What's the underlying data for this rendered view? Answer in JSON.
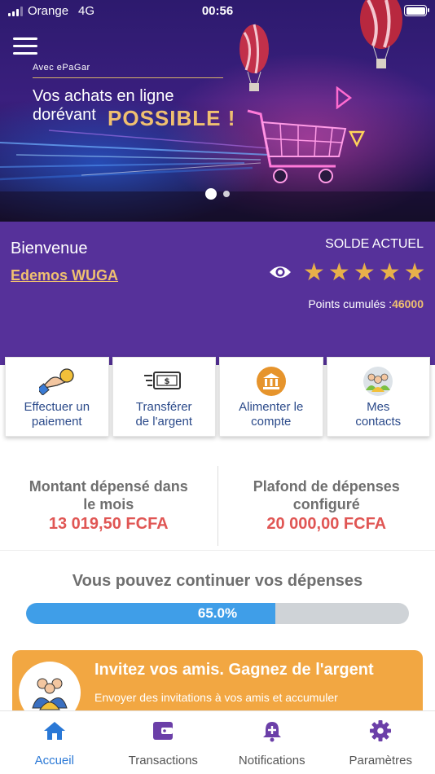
{
  "status_bar": {
    "carrier": "Orange",
    "network": "4G",
    "time": "00:56"
  },
  "banner": {
    "small": "Avec ePaGar",
    "line1": "Vos achats en ligne",
    "line2": "dorévant",
    "highlight": "POSSIBLE !",
    "slides": 2,
    "active_slide": 1
  },
  "welcome": {
    "greeting": "Bienvenue",
    "username": "Edemos WUGA",
    "balance_label": "SOLDE ACTUEL",
    "stars": 5,
    "points_label": "Points cumulés :",
    "points_value": "46000"
  },
  "actions": [
    {
      "line1": "Effectuer un",
      "line2": "paiement",
      "icon": "hand-coin-icon"
    },
    {
      "line1": "Transférer",
      "line2": "de l'argent",
      "icon": "money-transfer-icon"
    },
    {
      "line1": "Alimenter le",
      "line2": "compte",
      "icon": "bank-icon"
    },
    {
      "line1": "Mes",
      "line2": "contacts",
      "icon": "contacts-group-icon"
    }
  ],
  "stats": {
    "spent_label_1": "Montant dépensé dans",
    "spent_label_2": "le mois",
    "spent_value": "13 019,50 FCFA",
    "limit_label_1": "Plafond de dépenses",
    "limit_label_2": "configuré",
    "limit_value": "20 000,00 FCFA"
  },
  "progress": {
    "message": "Vous pouvez continuer vos dépenses",
    "percent": 65.0,
    "label": "65.0%"
  },
  "invite": {
    "title": "Invitez vos amis. Gagnez de l'argent",
    "subtitle": "Envoyer des invitations à vos amis et accumuler"
  },
  "tabs": [
    {
      "label": "Accueil",
      "icon": "home-icon",
      "active": true
    },
    {
      "label": "Transactions",
      "icon": "wallet-icon",
      "active": false
    },
    {
      "label": "Notifications",
      "icon": "bell-plus-icon",
      "active": false
    },
    {
      "label": "Paramètres",
      "icon": "gear-icon",
      "active": false
    }
  ],
  "colors": {
    "purple": "#56319a",
    "gold": "#f0c070",
    "accent_blue": "#2a78d6",
    "progress_blue": "#3f9ee8",
    "amount_red": "#e05654",
    "invite_orange": "#f2a742"
  }
}
